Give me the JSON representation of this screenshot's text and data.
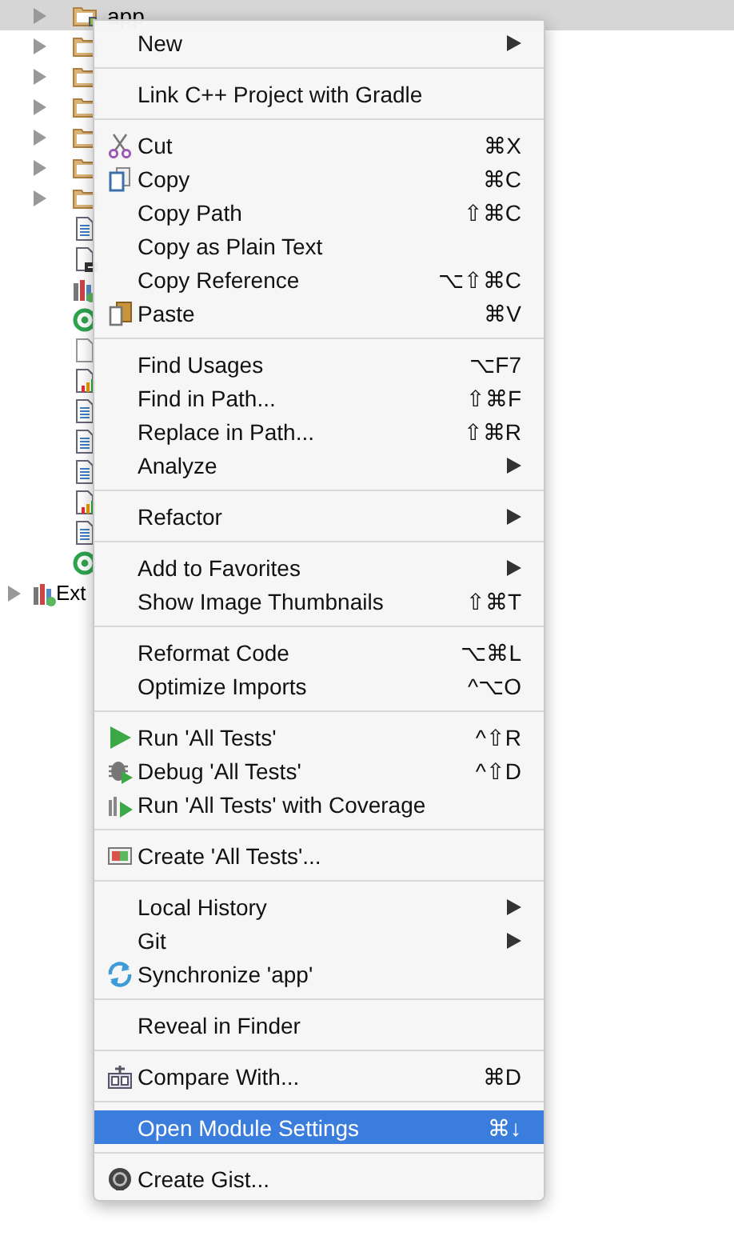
{
  "tree": [
    {
      "kind": "module",
      "label": "app",
      "expandable": true,
      "selected": true
    },
    {
      "kind": "folder",
      "expandable": true,
      "selected": false
    },
    {
      "kind": "folder",
      "expandable": true,
      "selected": false
    },
    {
      "kind": "folder",
      "expandable": true,
      "selected": false
    },
    {
      "kind": "folder",
      "expandable": true,
      "selected": false
    },
    {
      "kind": "folder",
      "expandable": true,
      "selected": false
    },
    {
      "kind": "folder",
      "expandable": true,
      "selected": false
    },
    {
      "kind": "text",
      "expandable": false,
      "selected": false
    },
    {
      "kind": "dash",
      "expandable": false,
      "selected": false
    },
    {
      "kind": "library",
      "expandable": false,
      "selected": false
    },
    {
      "kind": "gradle",
      "expandable": false,
      "selected": false
    },
    {
      "kind": "blank",
      "expandable": false,
      "selected": false
    },
    {
      "kind": "chart",
      "expandable": false,
      "selected": false
    },
    {
      "kind": "text",
      "expandable": false,
      "selected": false
    },
    {
      "kind": "text",
      "expandable": false,
      "selected": false
    },
    {
      "kind": "text",
      "expandable": false,
      "selected": false
    },
    {
      "kind": "chart",
      "expandable": false,
      "selected": false
    },
    {
      "kind": "text",
      "expandable": false,
      "selected": false
    },
    {
      "kind": "gradle",
      "expandable": false,
      "selected": false
    },
    {
      "kind": "library",
      "label": "Ext",
      "expandable": true,
      "selected": false,
      "root": true
    }
  ],
  "menu": [
    [
      {
        "label": "New",
        "submenu": true,
        "selected": false
      }
    ],
    [
      {
        "label": "Link C++ Project with Gradle",
        "selected": false
      }
    ],
    [
      {
        "label": "Cut",
        "shortcut": "⌘X",
        "kind": "scissors",
        "selected": false
      },
      {
        "label": "Copy",
        "shortcut": "⌘C",
        "kind": "copy",
        "selected": false
      },
      {
        "label": "Copy Path",
        "shortcut": "⇧⌘C",
        "selected": false
      },
      {
        "label": "Copy as Plain Text",
        "selected": false
      },
      {
        "label": "Copy Reference",
        "shortcut": "⌥⇧⌘C",
        "selected": false
      },
      {
        "label": "Paste",
        "shortcut": "⌘V",
        "kind": "paste",
        "selected": false
      }
    ],
    [
      {
        "label": "Find Usages",
        "shortcut": "⌥F7",
        "selected": false
      },
      {
        "label": "Find in Path...",
        "shortcut": "⇧⌘F",
        "selected": false
      },
      {
        "label": "Replace in Path...",
        "shortcut": "⇧⌘R",
        "selected": false
      },
      {
        "label": "Analyze",
        "submenu": true,
        "selected": false
      }
    ],
    [
      {
        "label": "Refactor",
        "submenu": true,
        "selected": false
      }
    ],
    [
      {
        "label": "Add to Favorites",
        "submenu": true,
        "selected": false
      },
      {
        "label": "Show Image Thumbnails",
        "shortcut": "⇧⌘T",
        "selected": false
      }
    ],
    [
      {
        "label": "Reformat Code",
        "shortcut": "⌥⌘L",
        "selected": false
      },
      {
        "label": "Optimize Imports",
        "shortcut": "^⌥O",
        "selected": false
      }
    ],
    [
      {
        "label": "Run 'All Tests'",
        "shortcut": "^⇧R",
        "kind": "run",
        "selected": false
      },
      {
        "label": "Debug 'All Tests'",
        "shortcut": "^⇧D",
        "kind": "debug",
        "selected": false
      },
      {
        "label": "Run 'All Tests' with Coverage",
        "kind": "coverage",
        "selected": false
      }
    ],
    [
      {
        "label": "Create 'All Tests'...",
        "kind": "create",
        "selected": false
      }
    ],
    [
      {
        "label": "Local History",
        "submenu": true,
        "selected": false
      },
      {
        "label": "Git",
        "submenu": true,
        "selected": false
      },
      {
        "label": "Synchronize 'app'",
        "kind": "sync",
        "selected": false
      }
    ],
    [
      {
        "label": "Reveal in Finder",
        "selected": false
      }
    ],
    [
      {
        "label": "Compare With...",
        "shortcut": "⌘D",
        "kind": "compare",
        "selected": false
      }
    ],
    [
      {
        "label": "Open Module Settings",
        "shortcut": "⌘↓",
        "selected": true
      }
    ],
    [
      {
        "label": "Create Gist...",
        "kind": "github",
        "selected": false
      }
    ]
  ]
}
